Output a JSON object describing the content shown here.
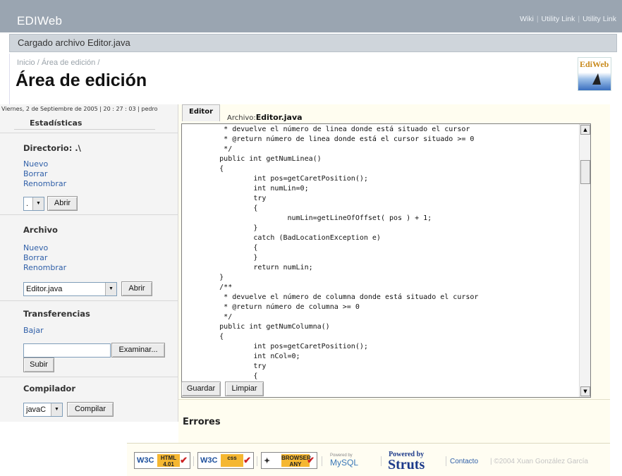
{
  "app": {
    "title": "EDIWeb"
  },
  "utility_links": [
    "Wiki",
    "Utility Link",
    "Utility Link"
  ],
  "status": {
    "message": "Cargado archivo Editor.java"
  },
  "header": {
    "breadcrumb": "Inicio / Área de edición /",
    "title": "Área de edición",
    "logo_text": "EdiWeb"
  },
  "sidebar": {
    "datebar": "Viernes, 2 de Septiembre de 2005 | 20 : 27 : 03 | pedro",
    "stats_title": "Estadísticas",
    "directorio": {
      "title": "Directorio: .\\",
      "links": [
        "Nuevo",
        "Borrar",
        "Renombrar"
      ],
      "select_value": ".",
      "button": "Abrir"
    },
    "archivo": {
      "title": "Archivo",
      "links": [
        "Nuevo",
        "Borrar",
        "Renombrar"
      ],
      "select_value": "Editor.java",
      "button": "Abrir"
    },
    "transferencias": {
      "title": "Transferencias",
      "link": "Bajar",
      "file_button": "Examinar...",
      "upload_button": "Subir"
    },
    "compilador": {
      "title": "Compilador",
      "select_value": "javaC",
      "button": "Compilar"
    }
  },
  "editor": {
    "tab": "Editor",
    "file_prefix": "Archivo:",
    "file_name": "Editor.java",
    "code_lines": [
      "         * devuelve el número de linea donde está situado el cursor",
      "         * @return número de linea donde está el cursor situado >= 0",
      "         */",
      "        public int getNumLinea()",
      "        {",
      "                int pos=getCaretPosition();",
      "                int numLin=0;",
      "                try",
      "                {",
      "                        numLin=getLineOfOffset( pos ) + 1;",
      "                }",
      "                catch (BadLocationException e)",
      "                {",
      "                }",
      "                return numLin;",
      "        }",
      "        /**",
      "         * devuelve el número de columna donde está situado el cursor",
      "         * @return número de columna >= 0",
      "         */",
      "        public int getNumColumna()",
      "        {",
      "                int pos=getCaretPosition();",
      "                int nCol=0;",
      "                try",
      "                {"
    ],
    "buttons": {
      "save": "Guardar",
      "clear": "Limpiar"
    }
  },
  "errors": {
    "title": "Errores"
  },
  "footer": {
    "badges": {
      "html_w3c": "W3C",
      "html_text": "HTML 4.01",
      "css_w3c": "W3C",
      "css_text": "css",
      "browser_text": "BROWSER ANY"
    },
    "mysql_small": "Powered by",
    "mysql": "MySQL",
    "struts_top": "Powered by",
    "struts": "Struts",
    "contact": "Contacto",
    "copyright": "| ©2004 Xuan González García"
  }
}
